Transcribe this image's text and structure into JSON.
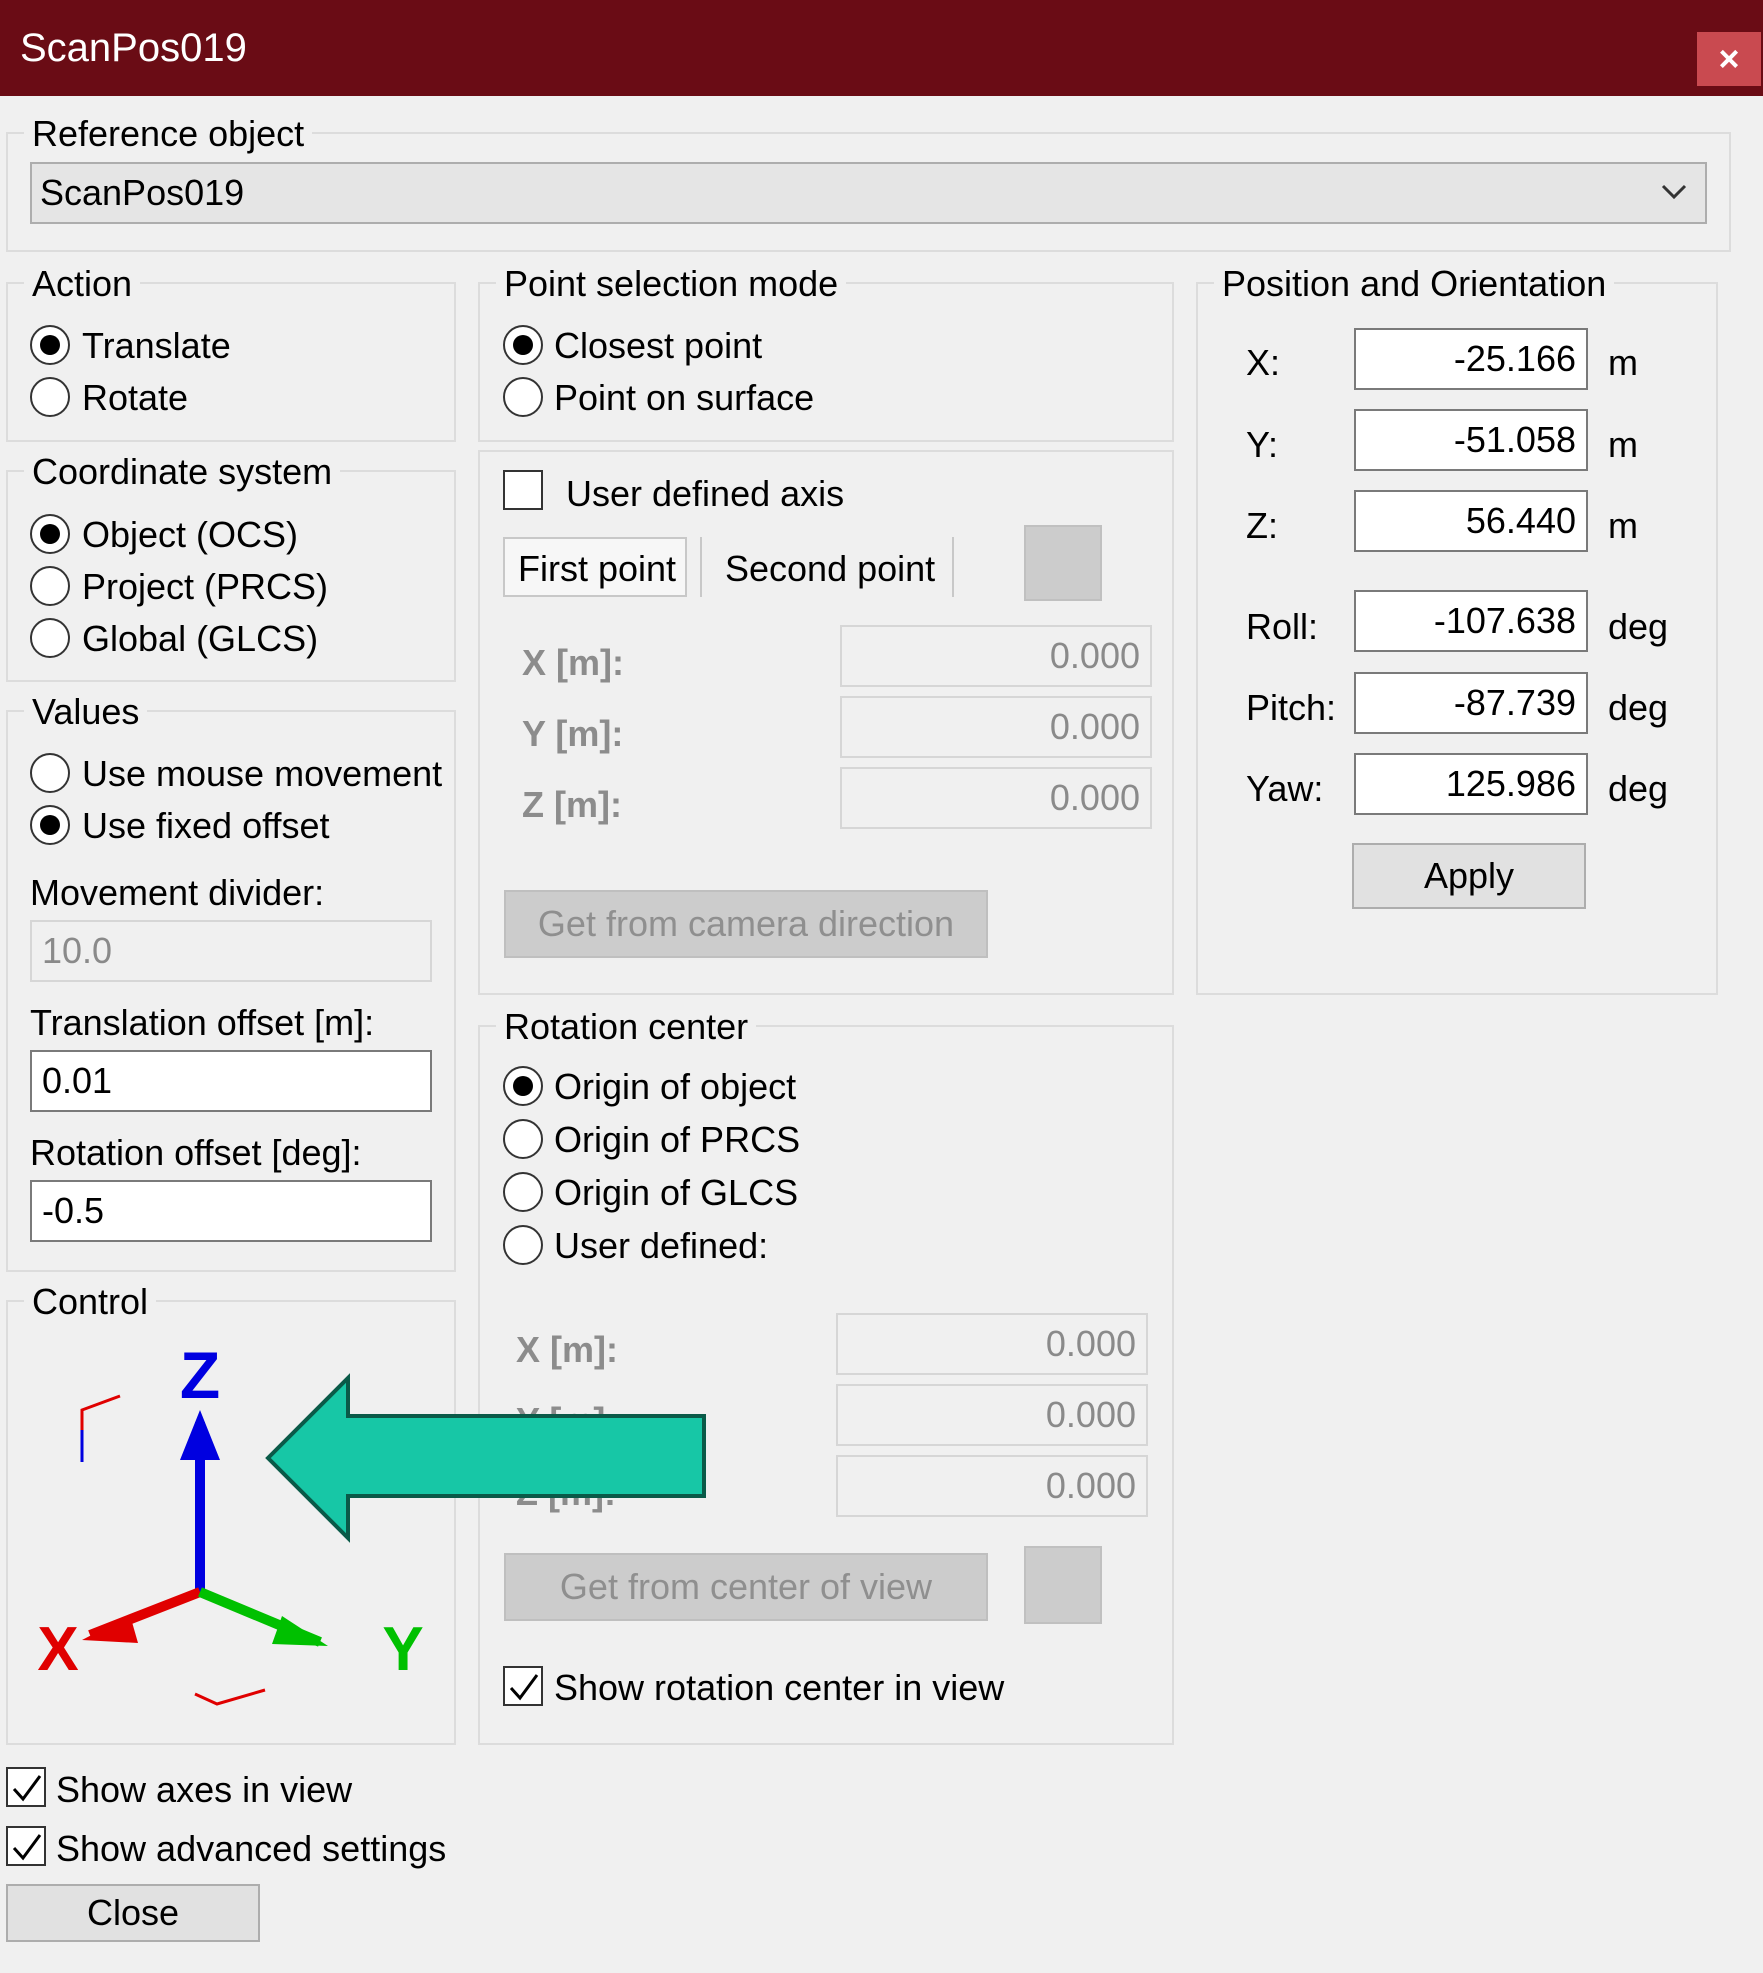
{
  "window": {
    "title": "ScanPos019",
    "close": "×"
  },
  "reference": {
    "label": "Reference object",
    "value": "ScanPos019"
  },
  "action": {
    "label": "Action",
    "options": [
      "Translate",
      "Rotate"
    ],
    "selected": "Translate"
  },
  "coordinate_system": {
    "label": "Coordinate system",
    "options": [
      "Object (OCS)",
      "Project (PRCS)",
      "Global (GLCS)"
    ],
    "selected": "Object (OCS)"
  },
  "values": {
    "label": "Values",
    "options": [
      "Use mouse movement",
      "Use fixed offset"
    ],
    "selected": "Use fixed offset",
    "movement_divider_label": "Movement divider:",
    "movement_divider": "10.0",
    "translation_offset_label": "Translation offset [m]:",
    "translation_offset": "0.01",
    "rotation_offset_label": "Rotation offset [deg]:",
    "rotation_offset": "-0.5"
  },
  "control": {
    "label": "Control",
    "axis_x": "X",
    "axis_y": "Y",
    "axis_z": "Z"
  },
  "point_selection": {
    "label": "Point selection mode",
    "options": [
      "Closest point",
      "Point on surface"
    ],
    "selected": "Closest point"
  },
  "user_axis": {
    "label": "User defined axis",
    "checked": false,
    "tabs": [
      "First point",
      "Second point"
    ],
    "active_tab": "First point",
    "fields": [
      {
        "label": "X [m]:",
        "value": "0.000"
      },
      {
        "label": "Y [m]:",
        "value": "0.000"
      },
      {
        "label": "Z [m]:",
        "value": "0.000"
      }
    ],
    "button": "Get from camera direction"
  },
  "rotation_center": {
    "label": "Rotation center",
    "options": [
      "Origin of object",
      "Origin of PRCS",
      "Origin of GLCS",
      "User defined:"
    ],
    "selected": "Origin of object",
    "fields": [
      {
        "label": "X [m]:",
        "value": "0.000"
      },
      {
        "label": "Y [m]:",
        "value": "0.000"
      },
      {
        "label": "Z [m]:",
        "value": "0.000"
      }
    ],
    "button": "Get from center of view",
    "show_label": "Show rotation center in view",
    "show_checked": true
  },
  "position": {
    "label": "Position and Orientation",
    "rows": [
      {
        "label": "X:",
        "value": "-25.166",
        "unit": "m"
      },
      {
        "label": "Y:",
        "value": "-51.058",
        "unit": "m"
      },
      {
        "label": "Z:",
        "value": "56.440",
        "unit": "m"
      },
      {
        "label": "Roll:",
        "value": "-107.638",
        "unit": "deg"
      },
      {
        "label": "Pitch:",
        "value": "-87.739",
        "unit": "deg"
      },
      {
        "label": "Yaw:",
        "value": "125.986",
        "unit": "deg"
      }
    ],
    "apply": "Apply"
  },
  "bottom": {
    "show_axes": "Show axes in view",
    "show_axes_checked": true,
    "show_advanced": "Show advanced settings",
    "show_advanced_checked": true,
    "close": "Close"
  },
  "colors": {
    "titlebar": "#6a0c15",
    "arrow": "#17c7a6",
    "axis_x": "#e00000",
    "axis_y": "#00c000",
    "axis_z": "#0000e0"
  }
}
